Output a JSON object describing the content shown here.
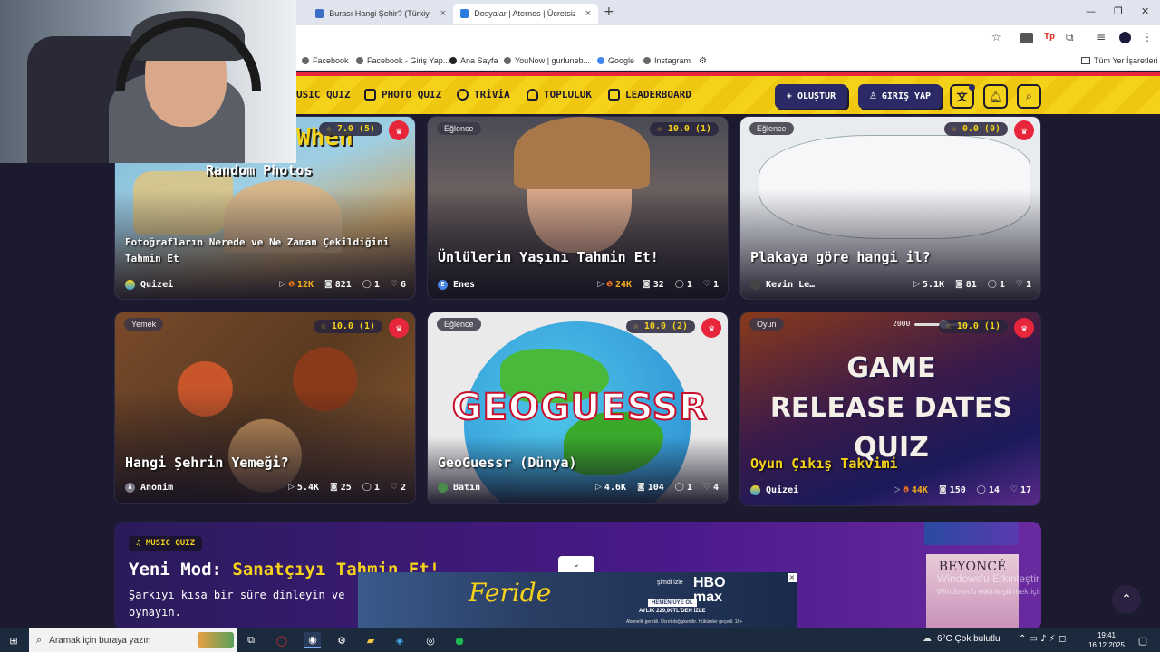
{
  "browser": {
    "tabs": [
      {
        "label": "Burası Hangi Şehir? (Türkiye) - Q",
        "close": "×"
      },
      {
        "label": "Dosyalar | Aternos | Ücretsiz Mi",
        "close": "×"
      }
    ],
    "new_tab": "+",
    "bookmarks": [
      "Facebook",
      "Facebook - Giriş Yap...",
      "Ana Sayfa",
      "YouNow | gurluneb...",
      "Google",
      "Instagram"
    ],
    "all_bookmarks": "Tüm Yer İşaretleri"
  },
  "site": {
    "nav": [
      "USIC QUIZ",
      "PHOTO QUIZ",
      "TRİVİA",
      "TOPLULUK",
      "LEADERBOARD"
    ],
    "create_button": "+ OLUŞTUR",
    "login_button": "GİRİŞ YAP"
  },
  "cards": [
    {
      "tag": "",
      "rating": "☆ 7.0 (5)",
      "title": "Fotoğrafların Nerede ve Ne Zaman Çekildiğini Tahmin Et",
      "thumb_text": [
        "When",
        "Random Photos"
      ],
      "author": "Quizei",
      "plays": "12K",
      "photos": "821",
      "comments": "1",
      "likes": "6",
      "hot": true
    },
    {
      "tag": "Eğlence",
      "rating": "☆ 10.0 (1)",
      "title": "Ünlülerin Yaşını Tahmin Et!",
      "author": "Enes",
      "author_initial": "E",
      "plays": "24K",
      "photos": "32",
      "comments": "1",
      "likes": "1",
      "hot": true
    },
    {
      "tag": "Eğlence",
      "rating": "☆ 0.0 (0)",
      "title": "Plakaya göre hangi il?",
      "author": "Kevin Le…",
      "plays": "5.1K",
      "photos": "81",
      "comments": "1",
      "likes": "1",
      "hot": false
    },
    {
      "tag": "Yemek",
      "rating": "☆ 10.0 (1)",
      "title": "Hangi Şehrin Yemeği?",
      "author": "Anonim",
      "author_initial": "A",
      "plays": "5.4K",
      "photos": "25",
      "comments": "1",
      "likes": "2",
      "hot": false
    },
    {
      "tag": "Eğlence",
      "rating": "☆ 10.0 (2)",
      "title": "GeoGuessr (Dünya)",
      "thumb_text": [
        "GEOGUESSR"
      ],
      "author": "Batın",
      "plays": "4.6K",
      "photos": "104",
      "comments": "1",
      "likes": "4",
      "hot": false
    },
    {
      "tag": "Oyun",
      "rating": "☆ 10.0 (1)",
      "title": "Oyun Çıkış Takvimi",
      "thumb_text": [
        "GAME",
        "RELEASE DATES",
        "QUIZ",
        "2000"
      ],
      "author": "Quizei",
      "plays": "44K",
      "photos": "150",
      "comments": "14",
      "likes": "17",
      "hot": true
    }
  ],
  "banner": {
    "badge": "♫ MUSIC QUIZ",
    "title_prefix": "Yeni Mod: ",
    "title_highlight": "Sanatçıyı Tahmin Et!",
    "desc_line1": "Şarkıyı kısa bir süre dinleyin ve",
    "desc_line2": "oynayın.",
    "album_text": "BEYONCÉ",
    "activation_line1": "Windows'u Etkinleştir",
    "activation_line2": "Windows'u etkinleştirmek için Ayarlar'a gidin."
  },
  "ad": {
    "title": "Feride",
    "brand": "HBO max",
    "small_top": "şimdi izle",
    "watch_now": "HEMEN ÜYE OL",
    "price": "AYLIK 229,99TL'DEN İZLE",
    "footer": "Abonelik gerekli. Ücret değişkendir. Hükümler geçerli. 18+"
  },
  "taskbar": {
    "search": "Aramak için buraya yazın",
    "weather": "6°C  Çok bulutlu",
    "time": "19:41",
    "date": "16.12.2025"
  }
}
